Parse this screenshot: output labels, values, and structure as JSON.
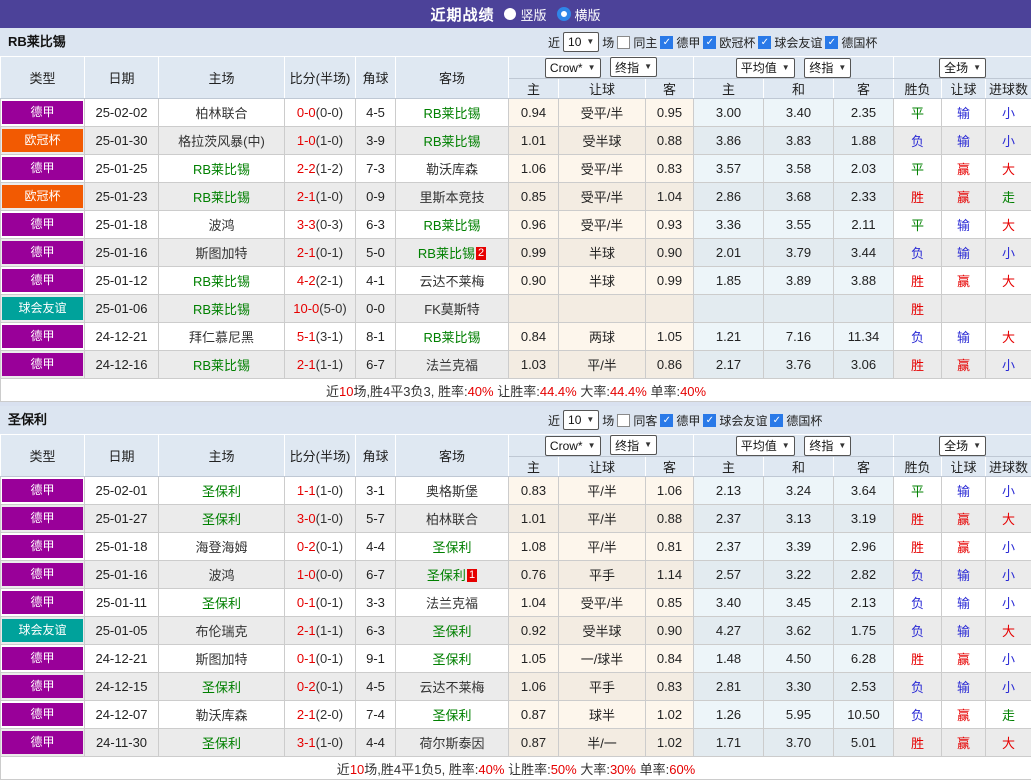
{
  "title_bar": {
    "title": "近期战绩",
    "radios": [
      {
        "label": "竖版",
        "checked": false
      },
      {
        "label": "横版",
        "checked": true
      }
    ]
  },
  "table_header": {
    "static_cols": [
      "类型",
      "日期",
      "主场",
      "比分(半场)",
      "角球",
      "客场"
    ],
    "odds_group": {
      "select1": "Crow*",
      "select2": "终指",
      "sub": [
        "主",
        "让球",
        "客"
      ]
    },
    "avg_group": {
      "select1": "平均值",
      "select2": "终指",
      "sub": [
        "主",
        "和",
        "客"
      ]
    },
    "result_group": {
      "select1": "全场",
      "sub": [
        "胜负",
        "让球",
        "进球数"
      ]
    }
  },
  "league_colors": {
    "德甲": "#990099",
    "欧冠杯": "#f25a02",
    "球会友谊": "#00a29b"
  },
  "colors": {
    "titlebar_purple": "#4c4299",
    "team_green": "#008000",
    "score_red": "#e60000",
    "win_red": "#e60000",
    "draw_green": "#008000",
    "lose_blue": "#2b2bd5",
    "checkbox_blue": "#2979e8",
    "row_stripe_gray": "#ebebeb",
    "odds_cream": "#fdf6ec",
    "avg_blue": "#edf5f9"
  },
  "sections": [
    {
      "team": "RB莱比锡",
      "filter": {
        "near": "近",
        "count": "10",
        "games": "场",
        "same_label": "同主",
        "same_checked": false,
        "leagues": [
          "德甲",
          "欧冠杯",
          "球会友谊",
          "德国杯"
        ]
      },
      "rows": [
        {
          "league": "德甲",
          "date": "25-02-02",
          "home": "柏林联合",
          "home_self": false,
          "score": "0-0",
          "half": "(0-0)",
          "corners": "4-5",
          "away": "RB莱比锡",
          "away_self": true,
          "away_card": "",
          "odds": [
            "0.94",
            "受平/半",
            "0.95"
          ],
          "avg": [
            "3.00",
            "3.40",
            "2.35"
          ],
          "res": [
            [
              "平",
              "g"
            ],
            [
              "输",
              "b"
            ],
            [
              "小",
              "b"
            ]
          ]
        },
        {
          "league": "欧冠杯",
          "date": "25-01-30",
          "home": "格拉茨风暴(中)",
          "home_self": false,
          "score": "1-0",
          "half": "(1-0)",
          "corners": "3-9",
          "away": "RB莱比锡",
          "away_self": true,
          "away_card": "",
          "odds": [
            "1.01",
            "受半球",
            "0.88"
          ],
          "avg": [
            "3.86",
            "3.83",
            "1.88"
          ],
          "res": [
            [
              "负",
              "b"
            ],
            [
              "输",
              "b"
            ],
            [
              "小",
              "b"
            ]
          ]
        },
        {
          "league": "德甲",
          "date": "25-01-25",
          "home": "RB莱比锡",
          "home_self": true,
          "score": "2-2",
          "half": "(1-2)",
          "corners": "7-3",
          "away": "勒沃库森",
          "away_self": false,
          "away_card": "",
          "odds": [
            "1.06",
            "受平/半",
            "0.83"
          ],
          "avg": [
            "3.57",
            "3.58",
            "2.03"
          ],
          "res": [
            [
              "平",
              "g"
            ],
            [
              "赢",
              "r"
            ],
            [
              "大",
              "r"
            ]
          ]
        },
        {
          "league": "欧冠杯",
          "date": "25-01-23",
          "home": "RB莱比锡",
          "home_self": true,
          "score": "2-1",
          "half": "(1-0)",
          "corners": "0-9",
          "away": "里斯本竞技",
          "away_self": false,
          "away_card": "",
          "odds": [
            "0.85",
            "受平/半",
            "1.04"
          ],
          "avg": [
            "2.86",
            "3.68",
            "2.33"
          ],
          "res": [
            [
              "胜",
              "r"
            ],
            [
              "赢",
              "r"
            ],
            [
              "走",
              "g"
            ]
          ]
        },
        {
          "league": "德甲",
          "date": "25-01-18",
          "home": "波鸿",
          "home_self": false,
          "score": "3-3",
          "half": "(0-3)",
          "corners": "6-3",
          "away": "RB莱比锡",
          "away_self": true,
          "away_card": "",
          "odds": [
            "0.96",
            "受平/半",
            "0.93"
          ],
          "avg": [
            "3.36",
            "3.55",
            "2.11"
          ],
          "res": [
            [
              "平",
              "g"
            ],
            [
              "输",
              "b"
            ],
            [
              "大",
              "r"
            ]
          ]
        },
        {
          "league": "德甲",
          "date": "25-01-16",
          "home": "斯图加特",
          "home_self": false,
          "score": "2-1",
          "half": "(0-1)",
          "corners": "5-0",
          "away": "RB莱比锡",
          "away_self": true,
          "away_card": "2",
          "odds": [
            "0.99",
            "半球",
            "0.90"
          ],
          "avg": [
            "2.01",
            "3.79",
            "3.44"
          ],
          "res": [
            [
              "负",
              "b"
            ],
            [
              "输",
              "b"
            ],
            [
              "小",
              "b"
            ]
          ]
        },
        {
          "league": "德甲",
          "date": "25-01-12",
          "home": "RB莱比锡",
          "home_self": true,
          "score": "4-2",
          "half": "(2-1)",
          "corners": "4-1",
          "away": "云达不莱梅",
          "away_self": false,
          "away_card": "",
          "odds": [
            "0.90",
            "半球",
            "0.99"
          ],
          "avg": [
            "1.85",
            "3.89",
            "3.88"
          ],
          "res": [
            [
              "胜",
              "r"
            ],
            [
              "赢",
              "r"
            ],
            [
              "大",
              "r"
            ]
          ]
        },
        {
          "league": "球会友谊",
          "date": "25-01-06",
          "home": "RB莱比锡",
          "home_self": true,
          "score": "10-0",
          "half": "(5-0)",
          "corners": "0-0",
          "away": "FK莫斯特",
          "away_self": false,
          "away_card": "",
          "odds": [
            "",
            "",
            ""
          ],
          "avg": [
            "",
            "",
            ""
          ],
          "res": [
            [
              "胜",
              "r"
            ],
            [
              "",
              ""
            ],
            [
              "",
              ""
            ]
          ]
        },
        {
          "league": "德甲",
          "date": "24-12-21",
          "home": "拜仁慕尼黑",
          "home_self": false,
          "score": "5-1",
          "half": "(3-1)",
          "corners": "8-1",
          "away": "RB莱比锡",
          "away_self": true,
          "away_card": "",
          "odds": [
            "0.84",
            "两球",
            "1.05"
          ],
          "avg": [
            "1.21",
            "7.16",
            "11.34"
          ],
          "res": [
            [
              "负",
              "b"
            ],
            [
              "输",
              "b"
            ],
            [
              "大",
              "r"
            ]
          ]
        },
        {
          "league": "德甲",
          "date": "24-12-16",
          "home": "RB莱比锡",
          "home_self": true,
          "score": "2-1",
          "half": "(1-1)",
          "corners": "6-7",
          "away": "法兰克福",
          "away_self": false,
          "away_card": "",
          "odds": [
            "1.03",
            "平/半",
            "0.86"
          ],
          "avg": [
            "2.17",
            "3.76",
            "3.06"
          ],
          "res": [
            [
              "胜",
              "r"
            ],
            [
              "赢",
              "r"
            ],
            [
              "小",
              "b"
            ]
          ]
        }
      ],
      "summary": [
        {
          "t": "近",
          "r": false
        },
        {
          "t": "10",
          "r": true
        },
        {
          "t": "场,胜4平3负3, 胜率:",
          "r": false
        },
        {
          "t": "40%",
          "r": true
        },
        {
          "t": " 让胜率:",
          "r": false
        },
        {
          "t": "44.4%",
          "r": true
        },
        {
          "t": " 大率:",
          "r": false
        },
        {
          "t": "44.4%",
          "r": true
        },
        {
          "t": " 单率:",
          "r": false
        },
        {
          "t": "40%",
          "r": true
        }
      ]
    },
    {
      "team": "圣保利",
      "filter": {
        "near": "近",
        "count": "10",
        "games": "场",
        "same_label": "同客",
        "same_checked": false,
        "leagues": [
          "德甲",
          "球会友谊",
          "德国杯"
        ]
      },
      "rows": [
        {
          "league": "德甲",
          "date": "25-02-01",
          "home": "圣保利",
          "home_self": true,
          "score": "1-1",
          "half": "(1-0)",
          "corners": "3-1",
          "away": "奥格斯堡",
          "away_self": false,
          "away_card": "",
          "odds": [
            "0.83",
            "平/半",
            "1.06"
          ],
          "avg": [
            "2.13",
            "3.24",
            "3.64"
          ],
          "res": [
            [
              "平",
              "g"
            ],
            [
              "输",
              "b"
            ],
            [
              "小",
              "b"
            ]
          ]
        },
        {
          "league": "德甲",
          "date": "25-01-27",
          "home": "圣保利",
          "home_self": true,
          "score": "3-0",
          "half": "(1-0)",
          "corners": "5-7",
          "away": "柏林联合",
          "away_self": false,
          "away_card": "",
          "odds": [
            "1.01",
            "平/半",
            "0.88"
          ],
          "avg": [
            "2.37",
            "3.13",
            "3.19"
          ],
          "res": [
            [
              "胜",
              "r"
            ],
            [
              "赢",
              "r"
            ],
            [
              "大",
              "r"
            ]
          ]
        },
        {
          "league": "德甲",
          "date": "25-01-18",
          "home": "海登海姆",
          "home_self": false,
          "score": "0-2",
          "half": "(0-1)",
          "corners": "4-4",
          "away": "圣保利",
          "away_self": true,
          "away_card": "",
          "odds": [
            "1.08",
            "平/半",
            "0.81"
          ],
          "avg": [
            "2.37",
            "3.39",
            "2.96"
          ],
          "res": [
            [
              "胜",
              "r"
            ],
            [
              "赢",
              "r"
            ],
            [
              "小",
              "b"
            ]
          ]
        },
        {
          "league": "德甲",
          "date": "25-01-16",
          "home": "波鸿",
          "home_self": false,
          "score": "1-0",
          "half": "(0-0)",
          "corners": "6-7",
          "away": "圣保利",
          "away_self": true,
          "away_card": "1",
          "odds": [
            "0.76",
            "平手",
            "1.14"
          ],
          "avg": [
            "2.57",
            "3.22",
            "2.82"
          ],
          "res": [
            [
              "负",
              "b"
            ],
            [
              "输",
              "b"
            ],
            [
              "小",
              "b"
            ]
          ]
        },
        {
          "league": "德甲",
          "date": "25-01-11",
          "home": "圣保利",
          "home_self": true,
          "score": "0-1",
          "half": "(0-1)",
          "corners": "3-3",
          "away": "法兰克福",
          "away_self": false,
          "away_card": "",
          "odds": [
            "1.04",
            "受平/半",
            "0.85"
          ],
          "avg": [
            "3.40",
            "3.45",
            "2.13"
          ],
          "res": [
            [
              "负",
              "b"
            ],
            [
              "输",
              "b"
            ],
            [
              "小",
              "b"
            ]
          ]
        },
        {
          "league": "球会友谊",
          "date": "25-01-05",
          "home": "布伦瑞克",
          "home_self": false,
          "score": "2-1",
          "half": "(1-1)",
          "corners": "6-3",
          "away": "圣保利",
          "away_self": true,
          "away_card": "",
          "odds": [
            "0.92",
            "受半球",
            "0.90"
          ],
          "avg": [
            "4.27",
            "3.62",
            "1.75"
          ],
          "res": [
            [
              "负",
              "b"
            ],
            [
              "输",
              "b"
            ],
            [
              "大",
              "r"
            ]
          ]
        },
        {
          "league": "德甲",
          "date": "24-12-21",
          "home": "斯图加特",
          "home_self": false,
          "score": "0-1",
          "half": "(0-1)",
          "corners": "9-1",
          "away": "圣保利",
          "away_self": true,
          "away_card": "",
          "odds": [
            "1.05",
            "一/球半",
            "0.84"
          ],
          "avg": [
            "1.48",
            "4.50",
            "6.28"
          ],
          "res": [
            [
              "胜",
              "r"
            ],
            [
              "赢",
              "r"
            ],
            [
              "小",
              "b"
            ]
          ]
        },
        {
          "league": "德甲",
          "date": "24-12-15",
          "home": "圣保利",
          "home_self": true,
          "score": "0-2",
          "half": "(0-1)",
          "corners": "4-5",
          "away": "云达不莱梅",
          "away_self": false,
          "away_card": "",
          "odds": [
            "1.06",
            "平手",
            "0.83"
          ],
          "avg": [
            "2.81",
            "3.30",
            "2.53"
          ],
          "res": [
            [
              "负",
              "b"
            ],
            [
              "输",
              "b"
            ],
            [
              "小",
              "b"
            ]
          ]
        },
        {
          "league": "德甲",
          "date": "24-12-07",
          "home": "勒沃库森",
          "home_self": false,
          "score": "2-1",
          "half": "(2-0)",
          "corners": "7-4",
          "away": "圣保利",
          "away_self": true,
          "away_card": "",
          "odds": [
            "0.87",
            "球半",
            "1.02"
          ],
          "avg": [
            "1.26",
            "5.95",
            "10.50"
          ],
          "res": [
            [
              "负",
              "b"
            ],
            [
              "赢",
              "r"
            ],
            [
              "走",
              "g"
            ]
          ]
        },
        {
          "league": "德甲",
          "date": "24-11-30",
          "home": "圣保利",
          "home_self": true,
          "score": "3-1",
          "half": "(1-0)",
          "corners": "4-4",
          "away": "荷尔斯泰因",
          "away_self": false,
          "away_card": "",
          "odds": [
            "0.87",
            "半/一",
            "1.02"
          ],
          "avg": [
            "1.71",
            "3.70",
            "5.01"
          ],
          "res": [
            [
              "胜",
              "r"
            ],
            [
              "赢",
              "r"
            ],
            [
              "大",
              "r"
            ]
          ]
        }
      ],
      "summary": [
        {
          "t": "近",
          "r": false
        },
        {
          "t": "10",
          "r": true
        },
        {
          "t": "场,胜4平1负5, 胜率:",
          "r": false
        },
        {
          "t": "40%",
          "r": true
        },
        {
          "t": " 让胜率:",
          "r": false
        },
        {
          "t": "50%",
          "r": true
        },
        {
          "t": " 大率:",
          "r": false
        },
        {
          "t": "30%",
          "r": true
        },
        {
          "t": " 单率:",
          "r": false
        },
        {
          "t": "60%",
          "r": true
        }
      ]
    }
  ]
}
